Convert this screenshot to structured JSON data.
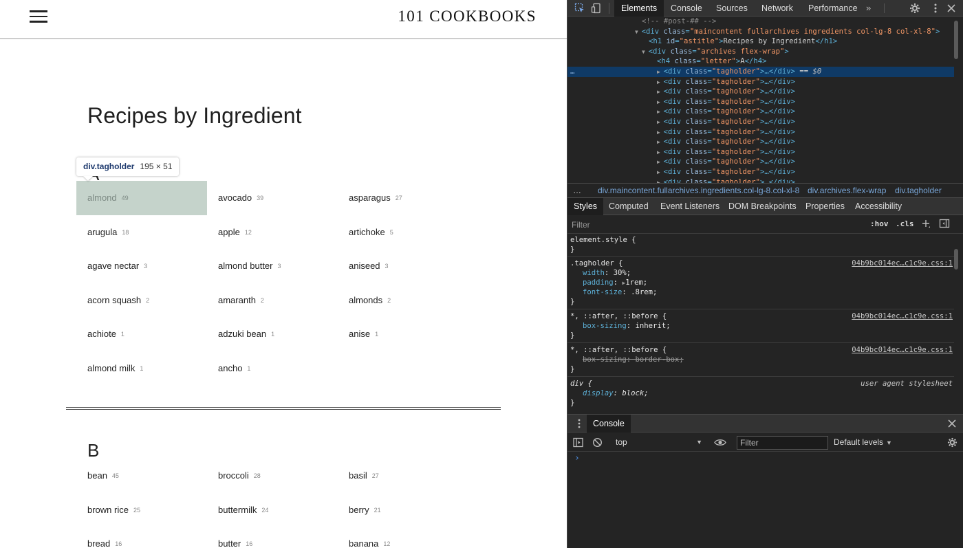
{
  "site": {
    "logo": "101 COOKBOOKS",
    "page_title": "Recipes by Ingredient",
    "sections": [
      {
        "letter": "A",
        "tags": [
          {
            "name": "almond",
            "count": "49"
          },
          {
            "name": "avocado",
            "count": "39"
          },
          {
            "name": "asparagus",
            "count": "27"
          },
          {
            "name": "arugula",
            "count": "18"
          },
          {
            "name": "apple",
            "count": "12"
          },
          {
            "name": "artichoke",
            "count": "5"
          },
          {
            "name": "agave nectar",
            "count": "3"
          },
          {
            "name": "almond butter",
            "count": "3"
          },
          {
            "name": "aniseed",
            "count": "3"
          },
          {
            "name": "acorn squash",
            "count": "2"
          },
          {
            "name": "amaranth",
            "count": "2"
          },
          {
            "name": "almonds",
            "count": "2"
          },
          {
            "name": "achiote",
            "count": "1"
          },
          {
            "name": "adzuki bean",
            "count": "1"
          },
          {
            "name": "anise",
            "count": "1"
          },
          {
            "name": "almond milk",
            "count": "1"
          },
          {
            "name": "ancho",
            "count": "1"
          }
        ]
      },
      {
        "letter": "B",
        "tags": [
          {
            "name": "bean",
            "count": "45"
          },
          {
            "name": "broccoli",
            "count": "28"
          },
          {
            "name": "basil",
            "count": "27"
          },
          {
            "name": "brown rice",
            "count": "25"
          },
          {
            "name": "buttermilk",
            "count": "24"
          },
          {
            "name": "berry",
            "count": "21"
          },
          {
            "name": "bread",
            "count": "16"
          },
          {
            "name": "butter",
            "count": "16"
          },
          {
            "name": "banana",
            "count": "12"
          }
        ]
      }
    ],
    "inspect_tooltip": {
      "element": "div.tagholder",
      "size": "195 × 51"
    },
    "highlight_color": "#c5d3cb"
  },
  "devtools": {
    "tabs": [
      "Elements",
      "Console",
      "Sources",
      "Network",
      "Performance"
    ],
    "more_tabs": "»",
    "dom_lines": [
      {
        "text": "<!-- #post-## -->",
        "kind": "comment"
      },
      {
        "tag_open": "<div ",
        "attr": "class",
        "value": "\"maincontent fullarchives ingredients col-lg-8 col-xl-8\"",
        "tail": ">"
      },
      {
        "tag_open": "<h1 ",
        "attr": "id",
        "value": "\"astitle\"",
        "tail": ">",
        "text": "Recipes by Ingredient",
        "close": "</h1>"
      },
      {
        "tag_open": "<div ",
        "attr": "class",
        "value": "\"archives flex-wrap\"",
        "tail": ">"
      },
      {
        "tag_open": "<h4 ",
        "attr": "class",
        "value": "\"letter\"",
        "tail": ">",
        "text": "A",
        "close": "</h4>"
      },
      {
        "tag_open": "<div ",
        "attr": "class",
        "value": "\"tagholder\"",
        "tail": ">…</div>",
        "suffix": " == ",
        "dollar": "$0"
      },
      {
        "tag_open": "<div ",
        "attr": "class",
        "value": "\"tagholder\"",
        "tail": ">…</div>"
      },
      {
        "tag_open": "<div ",
        "attr": "class",
        "value": "\"tagholder\"",
        "tail": ">…</div>"
      },
      {
        "tag_open": "<div ",
        "attr": "class",
        "value": "\"tagholder\"",
        "tail": ">…</div>"
      },
      {
        "tag_open": "<div ",
        "attr": "class",
        "value": "\"tagholder\"",
        "tail": ">…</div>"
      },
      {
        "tag_open": "<div ",
        "attr": "class",
        "value": "\"tagholder\"",
        "tail": ">…</div>"
      },
      {
        "tag_open": "<div ",
        "attr": "class",
        "value": "\"tagholder\"",
        "tail": ">…</div>"
      },
      {
        "tag_open": "<div ",
        "attr": "class",
        "value": "\"tagholder\"",
        "tail": ">…</div>"
      },
      {
        "tag_open": "<div ",
        "attr": "class",
        "value": "\"tagholder\"",
        "tail": ">…</div>"
      },
      {
        "tag_open": "<div ",
        "attr": "class",
        "value": "\"tagholder\"",
        "tail": ">…</div>"
      },
      {
        "tag_open": "<div ",
        "attr": "class",
        "value": "\"tagholder\"",
        "tail": ">…</div>"
      },
      {
        "tag_open": "<div ",
        "attr": "class",
        "value": "\"tagholder\"",
        "tail": ">…</div>"
      }
    ],
    "selected_dots": "…",
    "breadcrumbs": [
      "…",
      "div.maincontent.fullarchives.ingredients.col-lg-8.col-xl-8",
      "div.archives.flex-wrap",
      "div.tagholder"
    ],
    "style_tabs": [
      "Styles",
      "Computed",
      "Event Listeners",
      "DOM Breakpoints",
      "Properties",
      "Accessibility"
    ],
    "filter_placeholder": "Filter",
    "hov_label": ":hov",
    "cls_label": ".cls",
    "rules": {
      "element_style": {
        "selector": "element.style {",
        "close": "}"
      },
      "tagholder": {
        "selector": ".tagholder {",
        "source": "04b9bc014ec…c1c9e.css:1",
        "props": [
          {
            "name": "width",
            "value": "30%;"
          },
          {
            "name": "padding",
            "value": "1rem;"
          },
          {
            "name": "font-size",
            "value": ".8rem;"
          }
        ],
        "close": "}"
      },
      "universal_1": {
        "selector": "*, ::after, ::before {",
        "source": "04b9bc014ec…c1c9e.css:1",
        "props": [
          {
            "name": "box-sizing",
            "value": "inherit;"
          }
        ],
        "close": "}"
      },
      "universal_2": {
        "selector": "*, ::after, ::before {",
        "source": "04b9bc014ec…c1c9e.css:1",
        "props": [
          {
            "name": "box-sizing",
            "value": "border-box;"
          }
        ],
        "close": "}"
      },
      "div_ua": {
        "selector": "div {",
        "source": "user agent stylesheet",
        "props": [
          {
            "name": "display",
            "value": "block;"
          }
        ],
        "close": "}"
      }
    },
    "console": {
      "tab_label": "Console",
      "context": "top",
      "filter_placeholder": "Filter",
      "levels": "Default levels",
      "prompt": "›"
    }
  }
}
